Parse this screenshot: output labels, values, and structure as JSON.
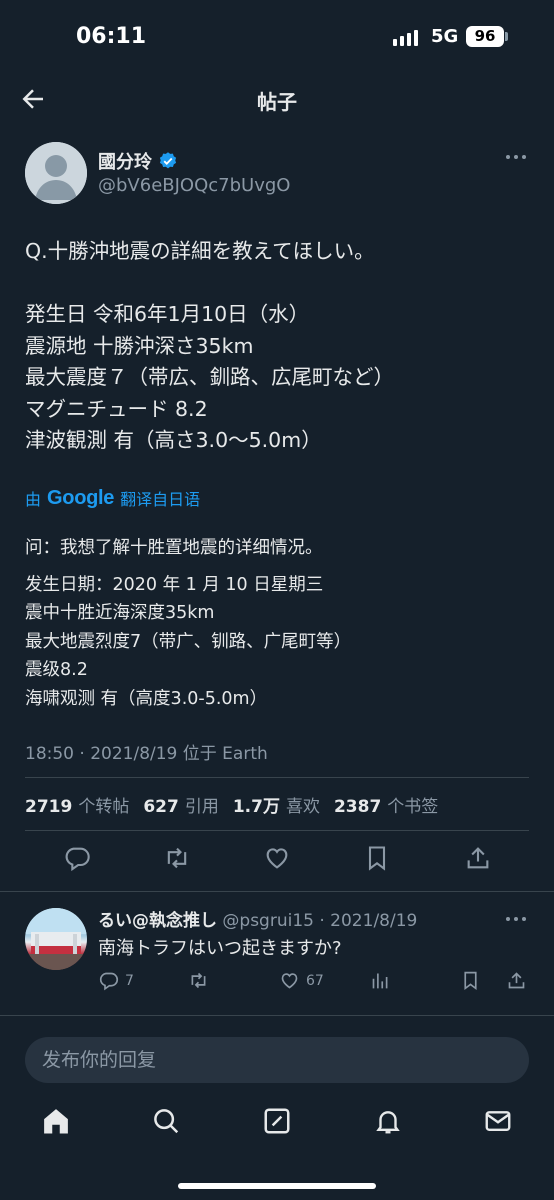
{
  "status_bar": {
    "time": "06:11",
    "network": "5G",
    "battery": "96"
  },
  "header": {
    "title": "帖子",
    "back_icon": "back-arrow-icon"
  },
  "tweet": {
    "author_name": "國分玲",
    "author_handle": "@bV6eBJOQc7bUvgO",
    "verified_icon": "verified-badge-icon",
    "body_lines": [
      "Q.十勝沖地震の詳細を教えてほしい。",
      "",
      "発生日 令和6年1月10日（水）",
      "震源地 十勝沖深さ35km",
      "最大震度７（帯広、釧路、広尾町など）",
      "マグニチュード 8.2",
      "津波観測 有（高さ3.0〜5.0m）"
    ],
    "translate_prefix": "由",
    "translate_brand": "Google",
    "translate_suffix": "翻译自日语",
    "translated_lines": [
      "问：我想了解十胜置地震的详细情况。",
      "",
      "发生日期：2020 年 1 月 10 日星期三",
      "震中十胜近海深度35km",
      "最大地震烈度7（带广、钏路、广尾町等）",
      "震级8.2",
      "海啸观测 有（高度3.0-5.0m）"
    ],
    "meta": "18:50 · 2021/8/19 位于 Earth",
    "stats": {
      "retweets_count": "2719",
      "retweets_label": "个转帖",
      "quotes_count": "627",
      "quotes_label": "引用",
      "likes_count": "1.7万",
      "likes_label": "喜欢",
      "bookmarks_count": "2387",
      "bookmarks_label": "个书签"
    }
  },
  "reply": {
    "name": "るい@執念推し",
    "handle_date": "@psgrui15 · 2021/8/19",
    "text": "南海トラフはいつ起きますか?",
    "reply_count": "7",
    "like_count": "67"
  },
  "compose": {
    "placeholder": "发布你的回复"
  },
  "colors": {
    "background": "#15202b",
    "accent": "#1d9bf0",
    "muted": "#8b98a5",
    "text": "#e7e9ea"
  }
}
